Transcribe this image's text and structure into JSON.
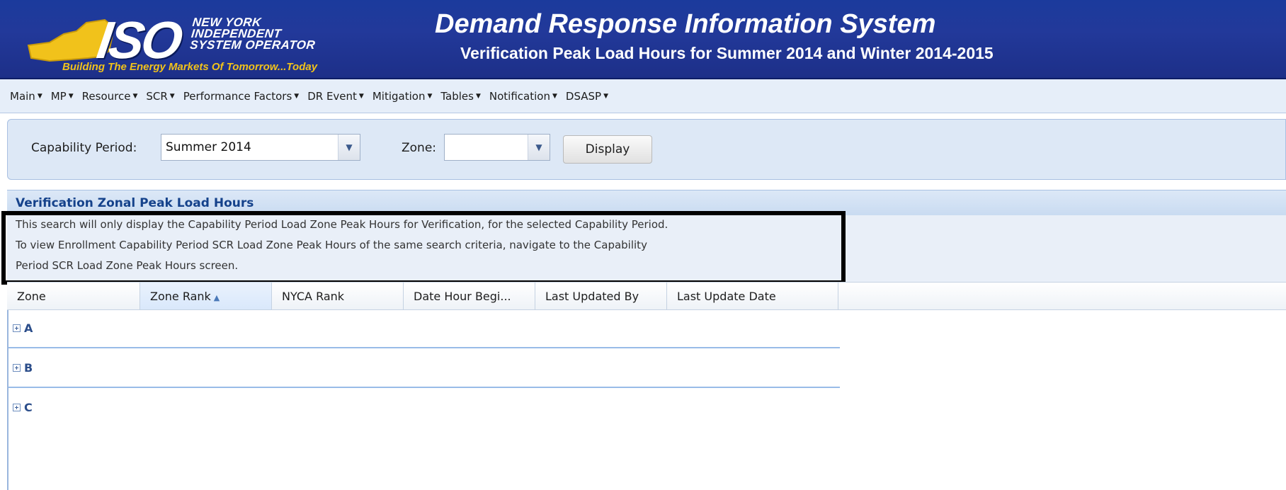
{
  "header": {
    "logo_iso": "ISO",
    "logo_org": "NEW YORK\nINDEPENDENT\nSYSTEM OPERATOR",
    "logo_tagline": "Building The Energy Markets Of Tomorrow...Today",
    "app_title": "Demand Response Information System",
    "page_subtitle": "Verification Peak Load Hours for Summer 2014 and Winter 2014-2015"
  },
  "menu": {
    "items": [
      "Main",
      "MP",
      "Resource",
      "SCR",
      "Performance Factors",
      "DR Event",
      "Mitigation",
      "Tables",
      "Notification",
      "DSASP"
    ]
  },
  "filters": {
    "capability_period_label": "Capability Period:",
    "capability_period_value": "Summer 2014",
    "zone_label": "Zone:",
    "zone_value": "",
    "display_button": "Display"
  },
  "section": {
    "title": "Verification Zonal Peak Load Hours"
  },
  "notice": {
    "lines": [
      "This search will only display the Capability Period Load Zone Peak Hours for Verification, for the selected Capability Period.",
      "To view Enrollment Capability Period SCR Load Zone Peak Hours of the same search criteria, navigate to the Capability",
      "Period SCR Load Zone Peak Hours screen."
    ]
  },
  "grid": {
    "columns": [
      "Zone",
      "Zone Rank",
      "NYCA Rank",
      "Date Hour Begi...",
      "Last Updated By",
      "Last Update Date"
    ],
    "sorted_column": "Zone Rank",
    "groups": [
      "A",
      "B",
      "C"
    ]
  },
  "colors": {
    "header_bg": "#1d3593",
    "tagline": "#f1c21b",
    "menu_bg": "#e6eef9",
    "section_title": "#15428b",
    "notice_border": "#000000"
  }
}
